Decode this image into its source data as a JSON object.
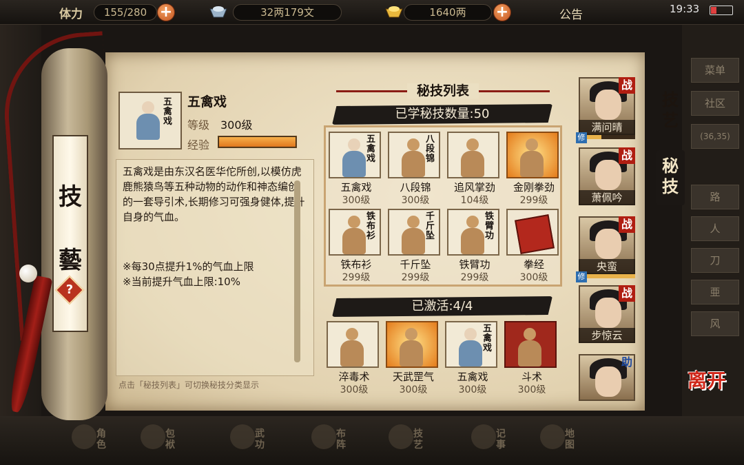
{
  "topbar": {
    "stamina_label": "体力",
    "stamina_value": "155/280",
    "silver_value": "32两179文",
    "gold_value": "1640两",
    "notice_label": "公告",
    "time": "19:33",
    "battery_level": 0.25
  },
  "right_menu": [
    "菜单",
    "社区",
    "(36,35)",
    "路",
    "人",
    "刀",
    "亜",
    "风"
  ],
  "bottom_nav": [
    {
      "label": "角色",
      "icon": "character-icon"
    },
    {
      "label": "包袱",
      "icon": "bag-icon"
    },
    {
      "label": "武功",
      "icon": "martial-arts-icon"
    },
    {
      "label": "布阵",
      "icon": "formation-icon"
    },
    {
      "label": "技艺",
      "icon": "skills-icon"
    },
    {
      "label": "记事",
      "icon": "journal-icon"
    },
    {
      "label": "地图",
      "icon": "map-icon"
    }
  ],
  "scroll": {
    "title_top": "技",
    "title_bottom": "藝",
    "help": "?"
  },
  "detail": {
    "name": "五禽戏",
    "level_label": "等级",
    "level_value": "300级",
    "exp_label": "经验",
    "exp_progress": 1.0,
    "description": "五禽戏是由东汉名医华佗所创,以模仿虎鹿熊猿鸟等五种动物的动作和神态编创的一套导引术,长期修习可强身健体,提升自身的气血。",
    "note1": "※每30点提升1%的气血上限",
    "note2": "※当前提升气血上限:10%",
    "hint": "点击「秘技列表」可切换秘技分类显示"
  },
  "list": {
    "title": "秘技列表",
    "learned": "已学秘技数量:50",
    "activated": "已激活:4/4",
    "learned_skills": [
      {
        "name": "五禽戏",
        "level": "300级",
        "style": "blue",
        "mark": "五禽戏"
      },
      {
        "name": "八段锦",
        "level": "300级",
        "style": "plain",
        "mark": "八段锦"
      },
      {
        "name": "追风掌劲",
        "level": "104级",
        "style": "plain",
        "mark": ""
      },
      {
        "name": "金刚拳劲",
        "level": "299级",
        "style": "orange",
        "mark": ""
      },
      {
        "name": "铁布衫",
        "level": "299级",
        "style": "plain",
        "mark": "铁布衫"
      },
      {
        "name": "千斤坠",
        "level": "299级",
        "style": "plain",
        "mark": "千斤坠"
      },
      {
        "name": "铁臂功",
        "level": "299级",
        "style": "plain",
        "mark": "铁臂功"
      },
      {
        "name": "拳经",
        "level": "300级",
        "style": "book",
        "mark": ""
      }
    ],
    "active_skills": [
      {
        "name": "淬毒术",
        "level": "300级",
        "style": "plain",
        "mark": ""
      },
      {
        "name": "天武罡气",
        "level": "300级",
        "style": "orange",
        "mark": ""
      },
      {
        "name": "五禽戏",
        "level": "300级",
        "style": "blue",
        "mark": "五禽戏"
      },
      {
        "name": "斗术",
        "level": "300级",
        "style": "red",
        "mark": ""
      }
    ]
  },
  "characters": [
    {
      "name": "满问晴",
      "badge": "战",
      "tag": "修",
      "progress": 0.3
    },
    {
      "name": "萧佩吟",
      "badge": "战",
      "tag": "",
      "progress": 0
    },
    {
      "name": "央蛮",
      "badge": "战",
      "tag": "修",
      "progress": 1.0
    },
    {
      "name": "步惊云",
      "badge": "战",
      "tag": "",
      "progress": 0
    },
    {
      "name": "",
      "badge": "助",
      "tag": "",
      "progress": 0
    }
  ],
  "tabs": {
    "skills": "技艺",
    "secret": "秘技"
  },
  "close_label": "离开",
  "colors": {
    "accent_red": "#b01e12",
    "exp_orange": "#e0781e",
    "ink": "#1e1a17"
  }
}
